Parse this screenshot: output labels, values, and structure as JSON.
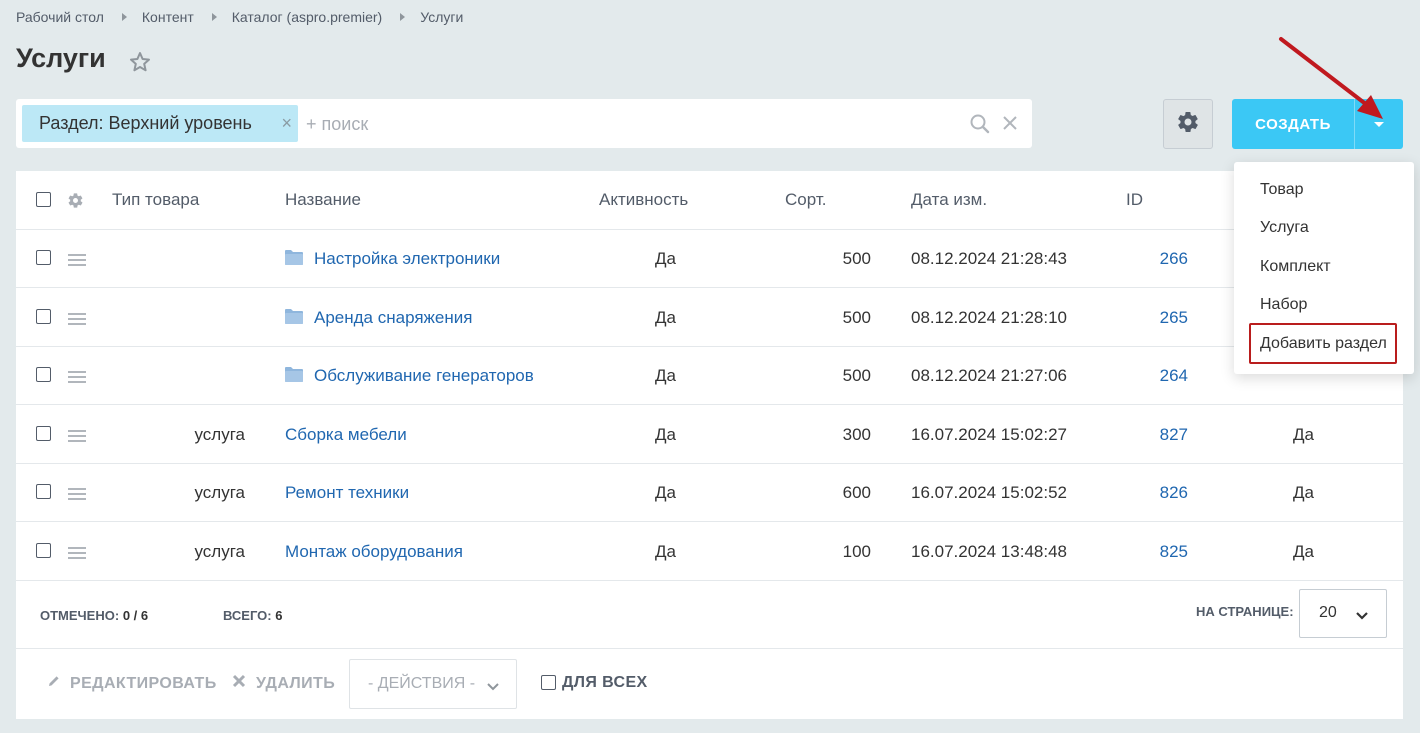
{
  "breadcrumb": [
    "Рабочий стол",
    "Контент",
    "Каталог (aspro.premier)",
    "Услуги"
  ],
  "page_title": "Услуги",
  "filter": {
    "tag_label": "Раздел: Верхний уровень",
    "tag_close": "×",
    "search_placeholder": "+ поиск"
  },
  "toolbar": {
    "create_label": "СОЗДАТЬ"
  },
  "table": {
    "columns": [
      "Тип товара",
      "Название",
      "Активность",
      "Сорт.",
      "Дата изм.",
      "ID"
    ],
    "rows": [
      {
        "type": "",
        "name": "Настройка электроники",
        "is_section": true,
        "active": "Да",
        "sort": "500",
        "date": "08.12.2024 21:28:43",
        "id": "266",
        "extra": ""
      },
      {
        "type": "",
        "name": "Аренда снаряжения",
        "is_section": true,
        "active": "Да",
        "sort": "500",
        "date": "08.12.2024 21:28:10",
        "id": "265",
        "extra": ""
      },
      {
        "type": "",
        "name": "Обслуживание генераторов",
        "is_section": true,
        "active": "Да",
        "sort": "500",
        "date": "08.12.2024 21:27:06",
        "id": "264",
        "extra": ""
      },
      {
        "type": "услуга",
        "name": "Сборка мебели",
        "is_section": false,
        "active": "Да",
        "sort": "300",
        "date": "16.07.2024 15:02:27",
        "id": "827",
        "extra": "Да"
      },
      {
        "type": "услуга",
        "name": "Ремонт техники",
        "is_section": false,
        "active": "Да",
        "sort": "600",
        "date": "16.07.2024 15:02:52",
        "id": "826",
        "extra": "Да"
      },
      {
        "type": "услуга",
        "name": "Монтаж оборудования",
        "is_section": false,
        "active": "Да",
        "sort": "100",
        "date": "16.07.2024 13:48:48",
        "id": "825",
        "extra": "Да"
      }
    ]
  },
  "footer": {
    "selected_label": "ОТМЕЧЕНО:",
    "selected_value": "0 / 6",
    "total_label": "ВСЕГО:",
    "total_value": "6",
    "per_page_label": "НА СТРАНИЦЕ:",
    "per_page_value": "20"
  },
  "actions": {
    "edit_label": "РЕДАКТИРОВАТЬ",
    "delete_label": "УДАЛИТЬ",
    "actions_select": "- ДЕЙСТВИЯ -",
    "for_all_label": "ДЛЯ ВСЕХ"
  },
  "create_menu": {
    "items": [
      "Товар",
      "Услуга",
      "Комплект",
      "Набор",
      "Добавить раздел"
    ]
  },
  "colors": {
    "accent": "#3bc8f5",
    "link": "#2067b0",
    "filter_tag": "#bce8f6",
    "highlight": "#b91d1d"
  }
}
